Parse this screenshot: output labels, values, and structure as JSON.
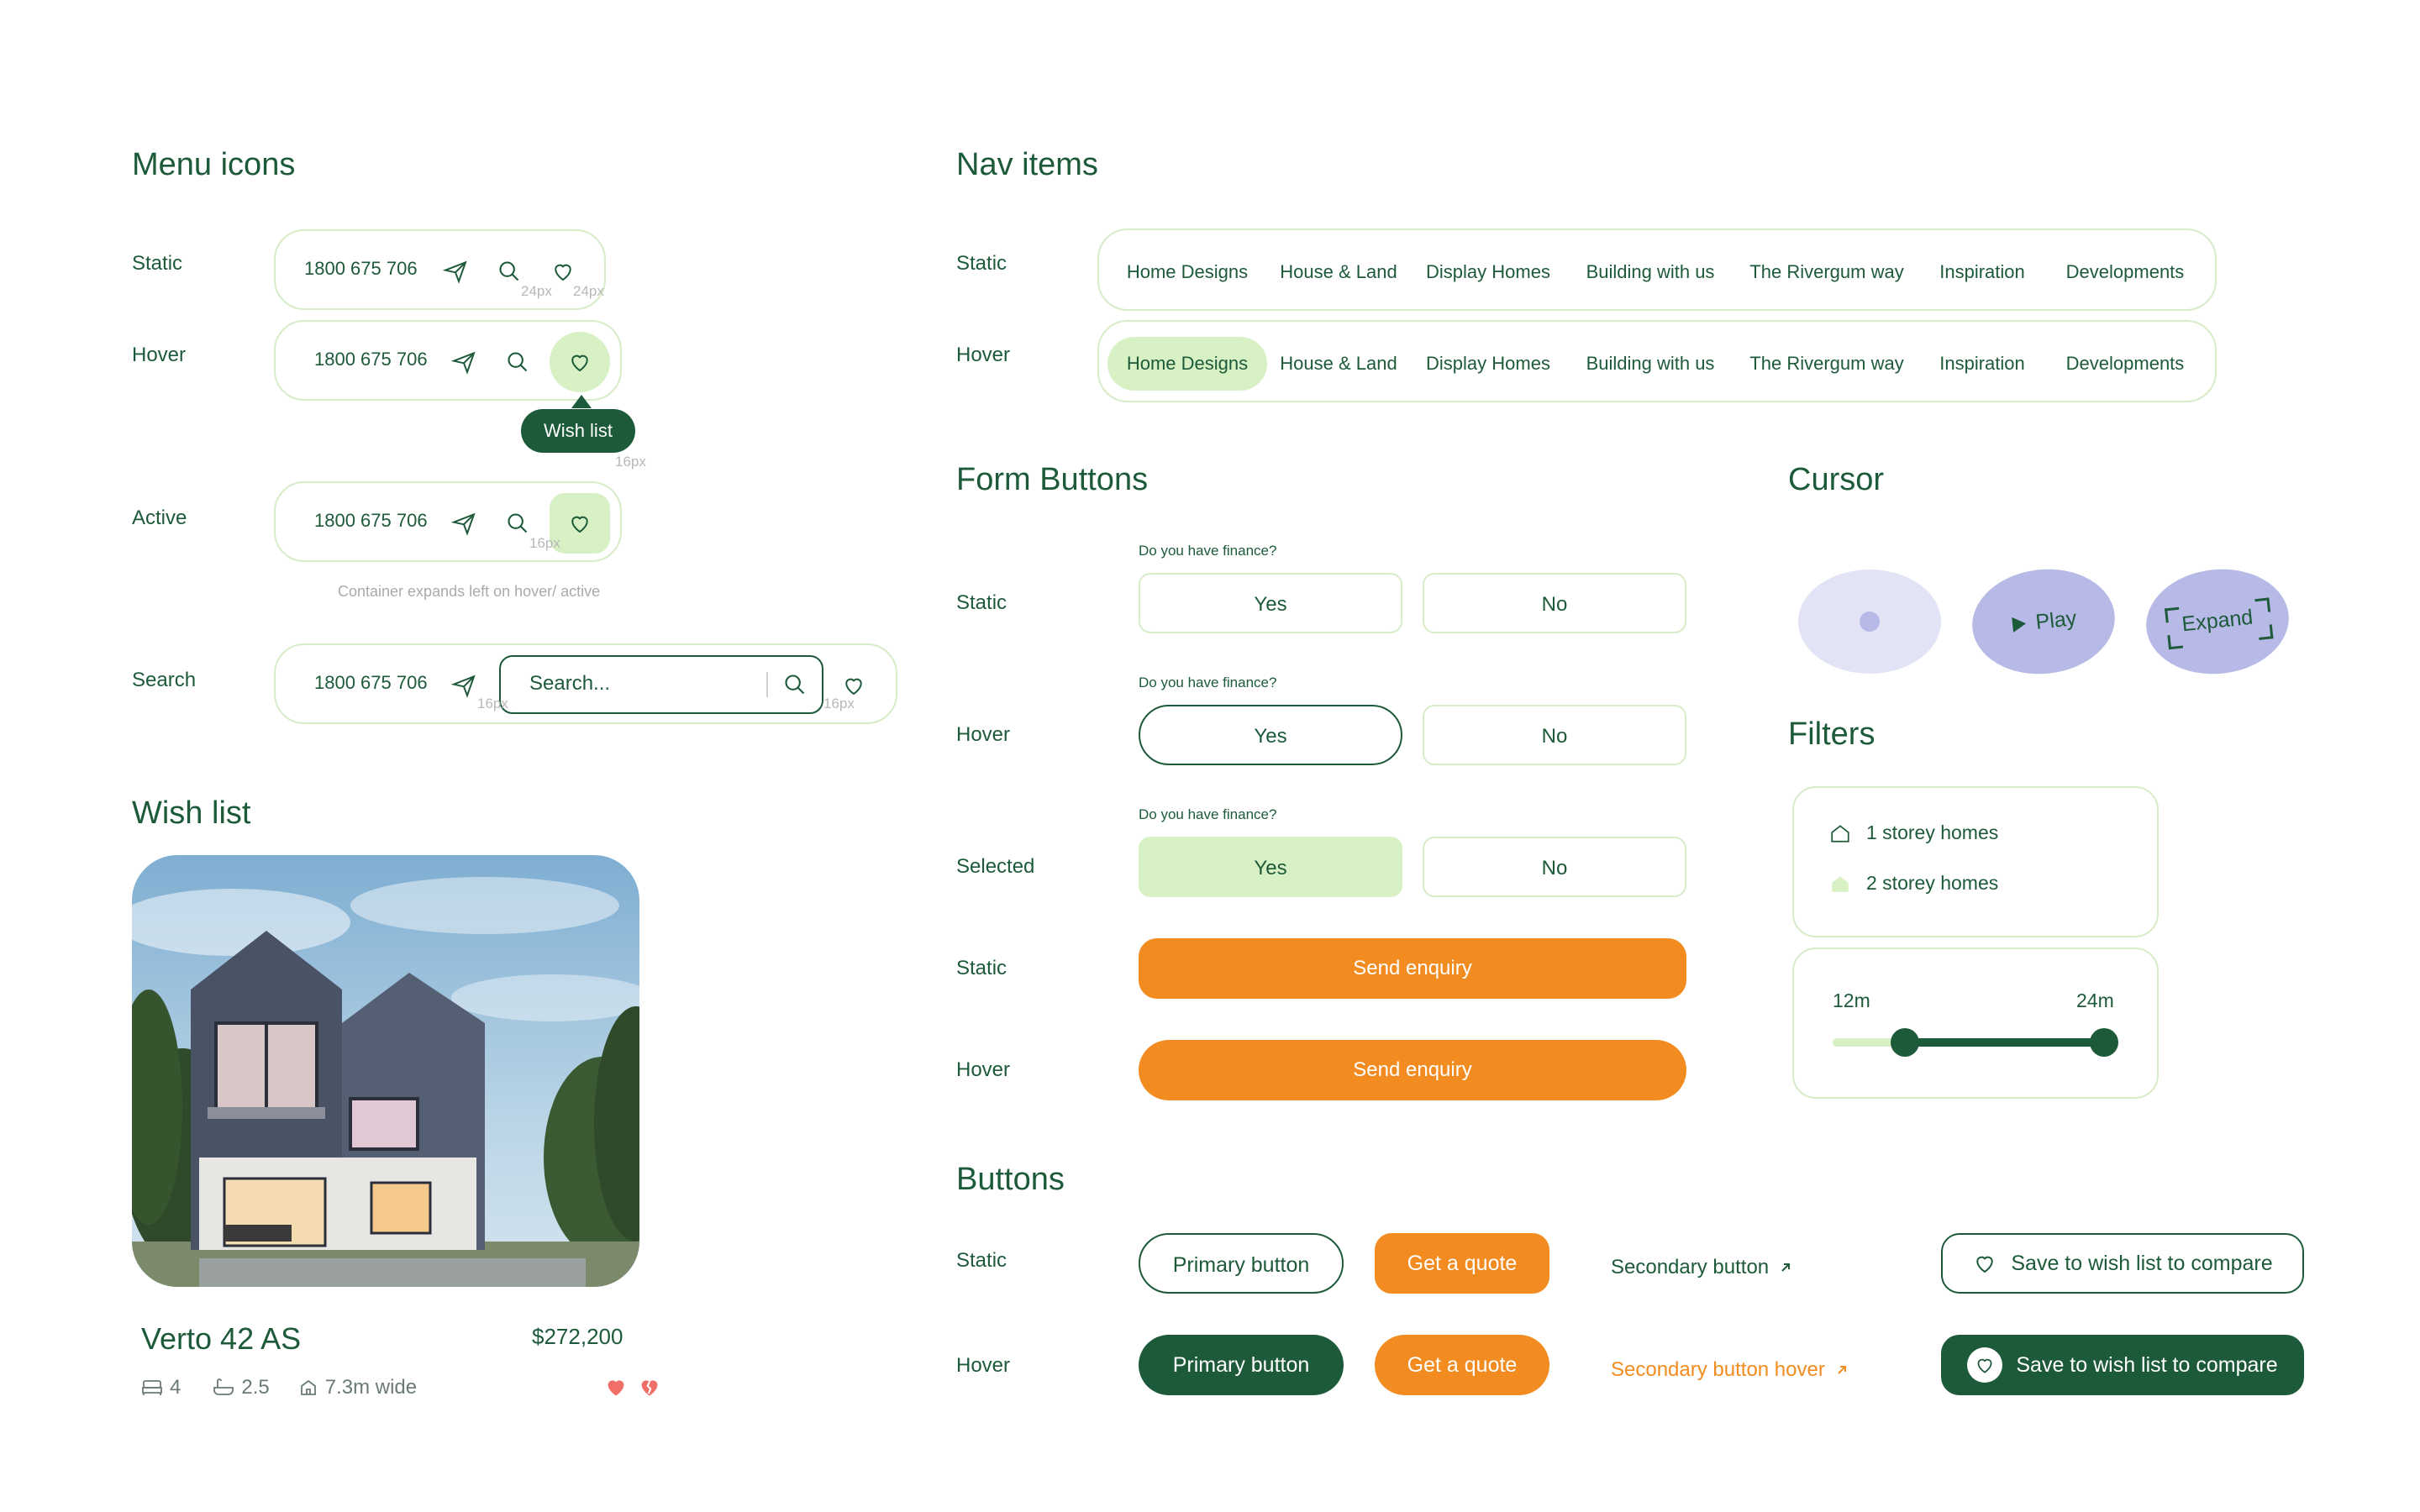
{
  "menu_icons": {
    "title": "Menu icons",
    "static_label": "Static",
    "hover_label": "Hover",
    "active_label": "Active",
    "search_label": "Search",
    "phone": "1800 675 706",
    "tooltip": "Wish list",
    "note": "Container expands left on hover/ active",
    "search_placeholder": "Search...",
    "spacing_24": "24px",
    "spacing_16": "16px"
  },
  "nav": {
    "title": "Nav items",
    "static_label": "Static",
    "hover_label": "Hover",
    "items": [
      "Home Designs",
      "House & Land",
      "Display Homes",
      "Building with us",
      "The Rivergum way",
      "Inspiration",
      "Developments"
    ]
  },
  "form_buttons": {
    "title": "Form Buttons",
    "question": "Do you have finance?",
    "yes": "Yes",
    "no": "No",
    "static_label": "Static",
    "hover_label": "Hover",
    "selected_label": "Selected",
    "send_label": "Send enquiry"
  },
  "cursor": {
    "title": "Cursor",
    "play": "Play",
    "expand": "Expand"
  },
  "filters": {
    "title": "Filters",
    "one_storey": "1 storey homes",
    "two_storey": "2 storey homes",
    "min": "12m",
    "max": "24m",
    "range_fraction": [
      0.26,
      0.98
    ]
  },
  "buttons": {
    "title": "Buttons",
    "static_label": "Static",
    "hover_label": "Hover",
    "primary": "Primary button",
    "quote": "Get a quote",
    "secondary": "Secondary button",
    "secondary_hover": "Secondary button hover",
    "wishlist": "Save to wish list to compare"
  },
  "wishlist": {
    "title": "Wish list",
    "name": "Verto 42 AS",
    "price": "$272,200",
    "beds": "4",
    "baths": "2.5",
    "width": "7.3m wide"
  },
  "colors": {
    "green_dark": "#1d5a3a",
    "green_light": "#d7f0c4",
    "orange": "#f28c20",
    "lavender": "#b7b9e6"
  }
}
